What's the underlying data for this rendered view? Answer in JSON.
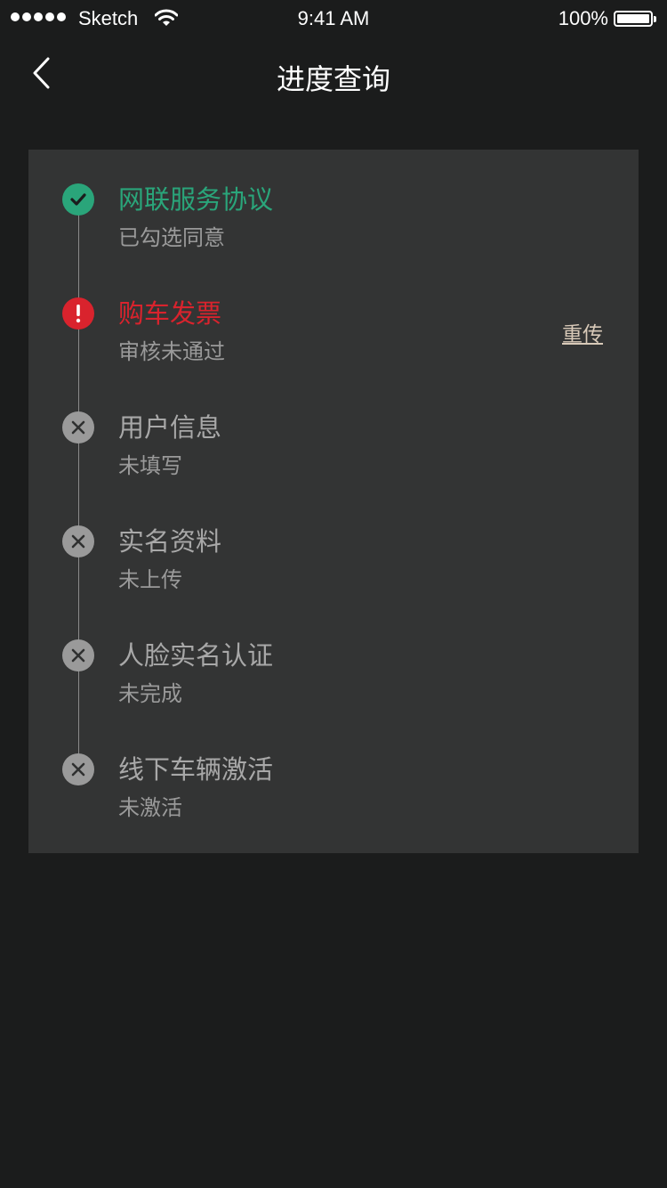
{
  "status_bar": {
    "carrier": "Sketch",
    "time": "9:41 AM",
    "battery": "100%"
  },
  "nav": {
    "title": "进度查询",
    "back_icon": "chevron-left-icon"
  },
  "colors": {
    "background": "#1b1c1c",
    "card": "#333434",
    "success": "#2aa57a",
    "error": "#d9232d",
    "pending": "#9a9a9a",
    "action_link": "#d8c9b8"
  },
  "steps": [
    {
      "title": "网联服务协议",
      "status_text": "已勾选同意",
      "state": "success",
      "icon": "check-circle-icon"
    },
    {
      "title": "购车发票",
      "status_text": "审核未通过",
      "state": "error",
      "icon": "alert-circle-icon",
      "action": "重传"
    },
    {
      "title": "用户信息",
      "status_text": "未填写",
      "state": "pending",
      "icon": "close-circle-icon"
    },
    {
      "title": "实名资料",
      "status_text": "未上传",
      "state": "pending",
      "icon": "close-circle-icon"
    },
    {
      "title": "人脸实名认证",
      "status_text": "未完成",
      "state": "pending",
      "icon": "close-circle-icon"
    },
    {
      "title": "线下车辆激活",
      "status_text": "未激活",
      "state": "pending",
      "icon": "close-circle-icon"
    }
  ]
}
